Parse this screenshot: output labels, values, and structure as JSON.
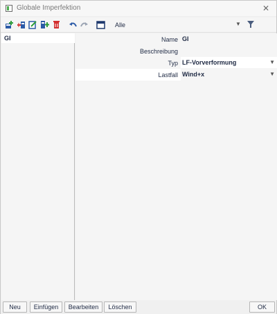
{
  "window": {
    "title": "Globale Imperfektion",
    "close_icon": "close-icon"
  },
  "toolbar": {
    "icons": [
      "new-item-icon",
      "insert-icon",
      "edit-icon",
      "copy-icon",
      "delete-icon",
      "undo-icon",
      "redo-icon",
      "window-icon"
    ],
    "filter_value": "Alle",
    "filter_icon": "funnel-icon"
  },
  "list": {
    "items": [
      {
        "label": "GI"
      }
    ]
  },
  "properties": {
    "name": {
      "label": "Name",
      "value": "GI"
    },
    "description": {
      "label": "Beschreibung",
      "value": ""
    },
    "type": {
      "label": "Typ",
      "value": "LF-Vorverformung"
    },
    "loadcase": {
      "label": "Lastfall",
      "value": "Wind+x"
    }
  },
  "buttons": {
    "new": "Neu",
    "insert": "Einfügen",
    "edit": "Bearbeiten",
    "delete": "Löschen",
    "ok": "OK"
  },
  "colors": {
    "accent": "#2b5aa7",
    "delete_red": "#d32f2f",
    "text": "#1f2a44"
  }
}
